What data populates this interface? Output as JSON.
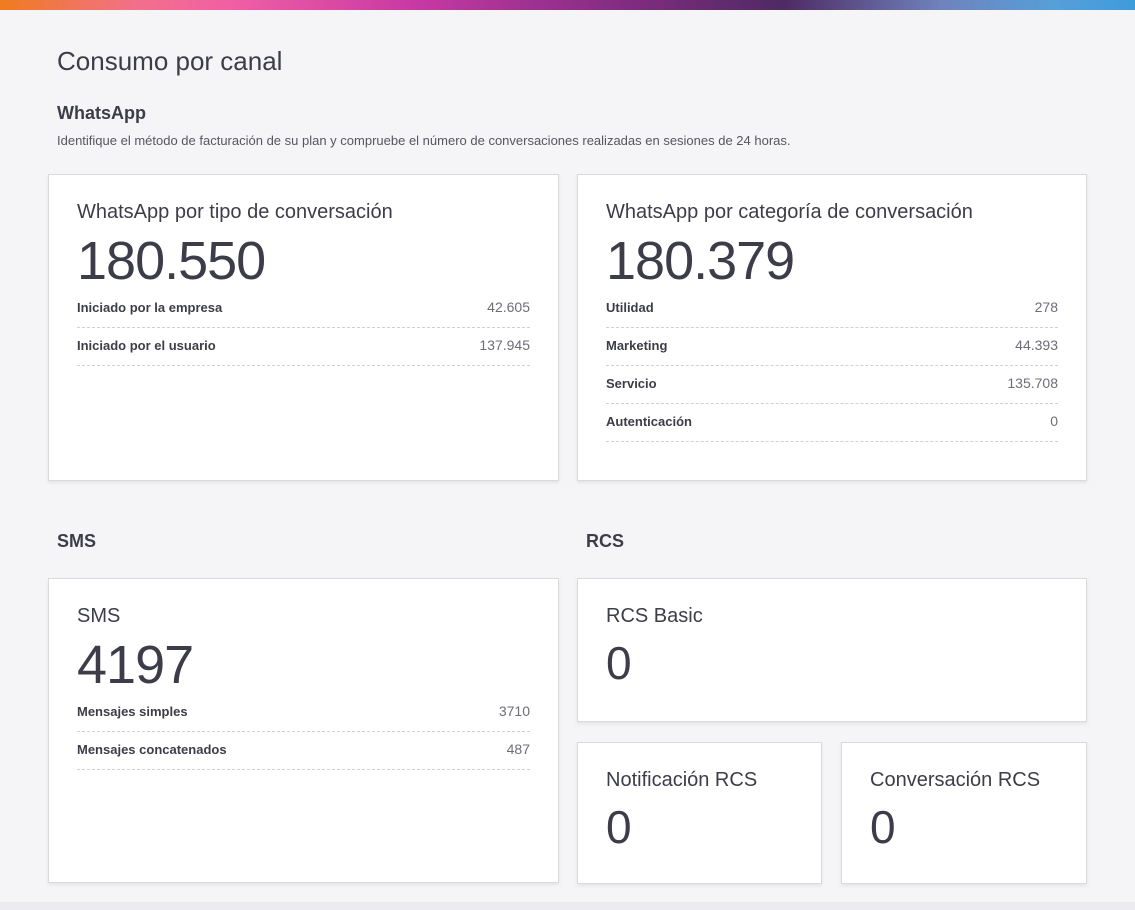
{
  "page": {
    "title": "Consumo por canal"
  },
  "whatsapp": {
    "heading": "WhatsApp",
    "description": "Identifique el método de facturación de su plan y compruebe el número de conversaciones realizadas en sesiones de 24 horas.",
    "cards": [
      {
        "title": "WhatsApp por tipo de conversación",
        "total": "180.550",
        "rows": [
          {
            "label": "Iniciado por la empresa",
            "value": "42.605"
          },
          {
            "label": "Iniciado por el usuario",
            "value": "137.945"
          }
        ]
      },
      {
        "title": "WhatsApp por categoría de conversación",
        "total": "180.379",
        "rows": [
          {
            "label": "Utilidad",
            "value": "278"
          },
          {
            "label": "Marketing",
            "value": "44.393"
          },
          {
            "label": "Servicio",
            "value": "135.708"
          },
          {
            "label": "Autenticación",
            "value": "0"
          }
        ]
      }
    ]
  },
  "sms": {
    "heading": "SMS",
    "card": {
      "title": "SMS",
      "total": "4197",
      "rows": [
        {
          "label": "Mensajes simples",
          "value": "3710"
        },
        {
          "label": "Mensajes concatenados",
          "value": "487"
        }
      ]
    }
  },
  "rcs": {
    "heading": "RCS",
    "cards": [
      {
        "title": "RCS Basic",
        "total": "0"
      },
      {
        "title": "Notificación RCS",
        "total": "0"
      },
      {
        "title": "Conversación RCS",
        "total": "0"
      }
    ]
  },
  "theme": {
    "page_background": "#f5f5f7",
    "card_background": "#ffffff",
    "card_border": "#d9d9de",
    "text_dark": "#3d3d49",
    "text_muted": "#6d6d79",
    "dashed_divider": "#cfcfd6",
    "header_gradient": [
      "#ef7c1e",
      "#f160a4",
      "#c93aa4",
      "#7e2c7f",
      "#4f2a63",
      "#6f83bd",
      "#3e9cdb"
    ]
  }
}
